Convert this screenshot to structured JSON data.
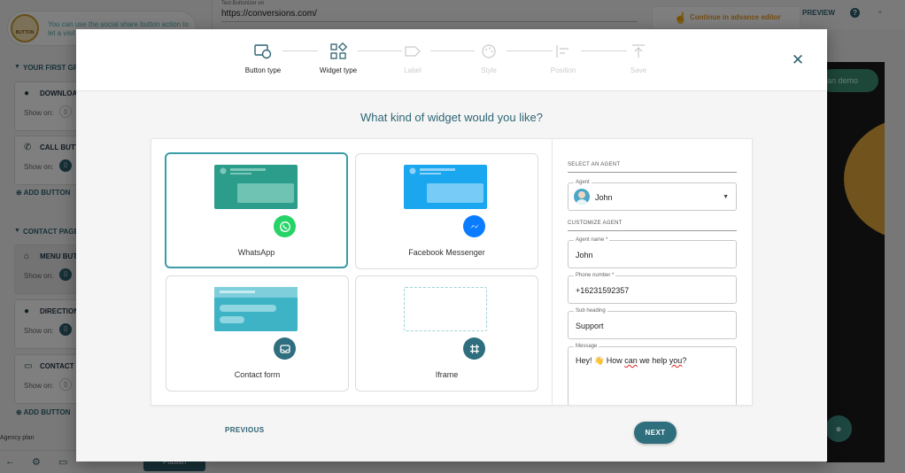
{
  "background": {
    "banner_text": "You can use the social share button action to let a visit",
    "logo_text": "BUTTON",
    "groups": [
      {
        "title": "YOUR FIRST GRO"
      },
      {
        "title": "CONTACT PAGE"
      }
    ],
    "cards": [
      {
        "title": "DOWNLOAD",
        "show_on": "Show on:"
      },
      {
        "title": "CALL BUTT",
        "show_on": "Show on:"
      },
      {
        "title": "MENU BUTT",
        "show_on": "Show on:"
      },
      {
        "title": "DIRECTIONS",
        "show_on": "Show on:"
      },
      {
        "title": "CONTACT F",
        "show_on": "Show on:"
      }
    ],
    "add_button_label": "ADD BUTTON",
    "agency_text": "Agency plan",
    "publish_label": "Publish",
    "url_label": "Test Buttonizer on",
    "url": "https://conversions.com/",
    "advance_editor": "Continue in advance editor",
    "preview_label": "PREVIEW",
    "demo_label": "an demo"
  },
  "modal": {
    "steps": [
      {
        "label": "Button type",
        "active": true,
        "icon": "button-type-icon"
      },
      {
        "label": "Widget type",
        "active": true,
        "icon": "widget-type-icon"
      },
      {
        "label": "Label",
        "active": false,
        "icon": "label-icon"
      },
      {
        "label": "Style",
        "active": false,
        "icon": "style-icon"
      },
      {
        "label": "Position",
        "active": false,
        "icon": "position-icon"
      },
      {
        "label": "Save",
        "active": false,
        "icon": "save-icon"
      }
    ],
    "question": "What kind of widget would you like?",
    "widgets": [
      {
        "label": "WhatsApp",
        "selected": true,
        "thumb_color": "#2b9d8a",
        "badge_color": "#25d366",
        "icon": "whatsapp-icon"
      },
      {
        "label": "Facebook Messenger",
        "selected": false,
        "thumb_color": "#1aa7f0",
        "badge_color": "#0a7cff",
        "icon": "messenger-icon"
      },
      {
        "label": "Contact form",
        "selected": false,
        "thumb_color": "#3fb3c6",
        "badge_color": "#2e6e7e",
        "icon": "contact-form-icon"
      },
      {
        "label": "Iframe",
        "selected": false,
        "thumb_color": "#ffffff",
        "badge_color": "#2e6e7e",
        "icon": "iframe-icon"
      }
    ],
    "agent_panel": {
      "select_agent_title": "SELECT AN AGENT",
      "agent_field_label": "Agent",
      "agent_value": "John",
      "customize_title": "CUSTOMIZE AGENT",
      "name_label": "Agent name *",
      "name_value": "John",
      "phone_label": "Phone number *",
      "phone_value": "+16231592357",
      "subheading_label": "Sub heading",
      "subheading_value": "Support",
      "message_label": "Message",
      "message_parts": {
        "p1": "Hey! ",
        "emoji": "👋",
        "p2": " How ",
        "can": "can",
        "p3": " we help ",
        "you": "you",
        "p4": "?"
      }
    },
    "previous_label": "PREVIOUS",
    "next_label": "NEXT"
  }
}
